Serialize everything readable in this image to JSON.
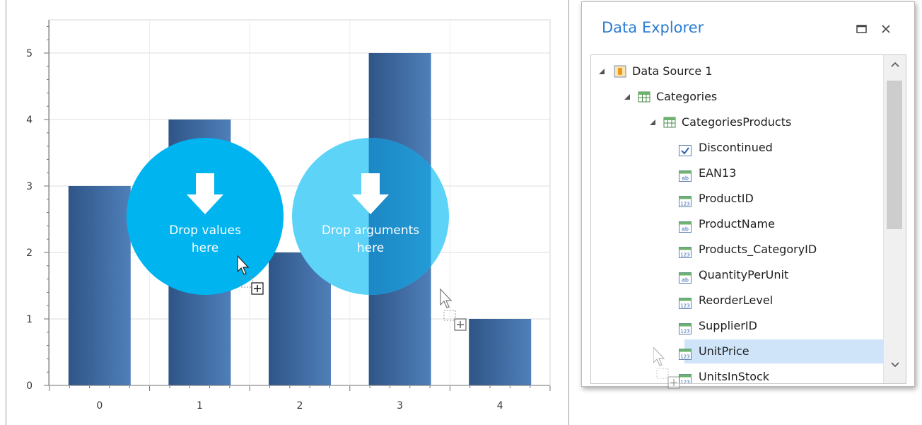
{
  "chart_data": {
    "type": "bar",
    "categories": [
      "0",
      "1",
      "2",
      "3",
      "4"
    ],
    "values": [
      3,
      4,
      2,
      5,
      1
    ],
    "ylim": [
      0,
      5.5
    ],
    "yticks": [
      "0",
      "1",
      "2",
      "3",
      "4",
      "5"
    ],
    "grid": true,
    "colors": {
      "bar_dark": "#2f5587",
      "bar_light": "#4f7fb9",
      "grid": "#dcdcdc"
    }
  },
  "drop_zones": {
    "values": {
      "line1": "Drop values",
      "line2": "here",
      "color": "#00b4ef"
    },
    "arguments": {
      "line1": "Drop arguments",
      "line2": "here",
      "color": "#5dd3f7"
    }
  },
  "data_explorer": {
    "title": "Data Explorer",
    "root": {
      "label": "Data Source 1",
      "icon": "database-icon"
    },
    "table": {
      "label": "Categories",
      "icon": "table-icon"
    },
    "relation": {
      "label": "CategoriesProducts",
      "icon": "table-icon"
    },
    "fields": [
      {
        "label": "Discontinued",
        "icon": "checkbox-field-icon",
        "type_label": ""
      },
      {
        "label": "EAN13",
        "icon": "text-field-icon",
        "type_label": "ab"
      },
      {
        "label": "ProductID",
        "icon": "number-field-icon",
        "type_label": "123"
      },
      {
        "label": "ProductName",
        "icon": "text-field-icon",
        "type_label": "ab"
      },
      {
        "label": "Products_CategoryID",
        "icon": "number-field-icon",
        "type_label": "123"
      },
      {
        "label": "QuantityPerUnit",
        "icon": "text-field-icon",
        "type_label": "ab"
      },
      {
        "label": "ReorderLevel",
        "icon": "number-field-icon",
        "type_label": "123"
      },
      {
        "label": "SupplierID",
        "icon": "number-field-icon",
        "type_label": "123"
      },
      {
        "label": "UnitPrice",
        "icon": "number-field-icon",
        "type_label": "123",
        "selected": true
      },
      {
        "label": "UnitsInStock",
        "icon": "number-field-icon",
        "type_label": "123"
      }
    ],
    "accent": "#2b7cd3",
    "selected_color": "#cfe4f8"
  }
}
